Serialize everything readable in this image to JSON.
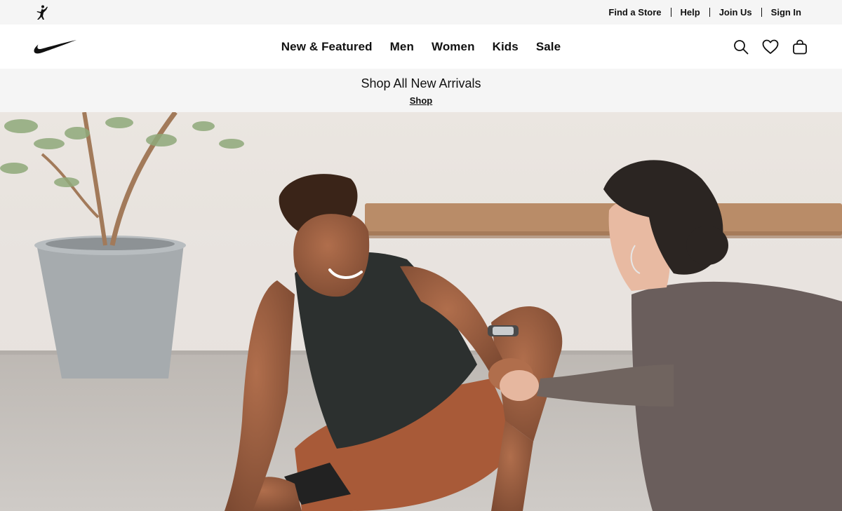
{
  "utility_bar": {
    "links": [
      "Find a Store",
      "Help",
      "Join Us",
      "Sign In"
    ]
  },
  "main_nav": {
    "items": [
      "New & Featured",
      "Men",
      "Women",
      "Kids",
      "Sale"
    ],
    "icons": [
      "search-icon",
      "favorites-heart-icon",
      "bag-icon"
    ]
  },
  "promo": {
    "title": "Shop All New Arrivals",
    "link": "Shop"
  },
  "hero": {
    "image": "two-people-training-fist-bump"
  },
  "colors": {
    "utility_bg": "#f5f5f5",
    "text": "#111111",
    "promo_bg": "#f5f5f5"
  }
}
